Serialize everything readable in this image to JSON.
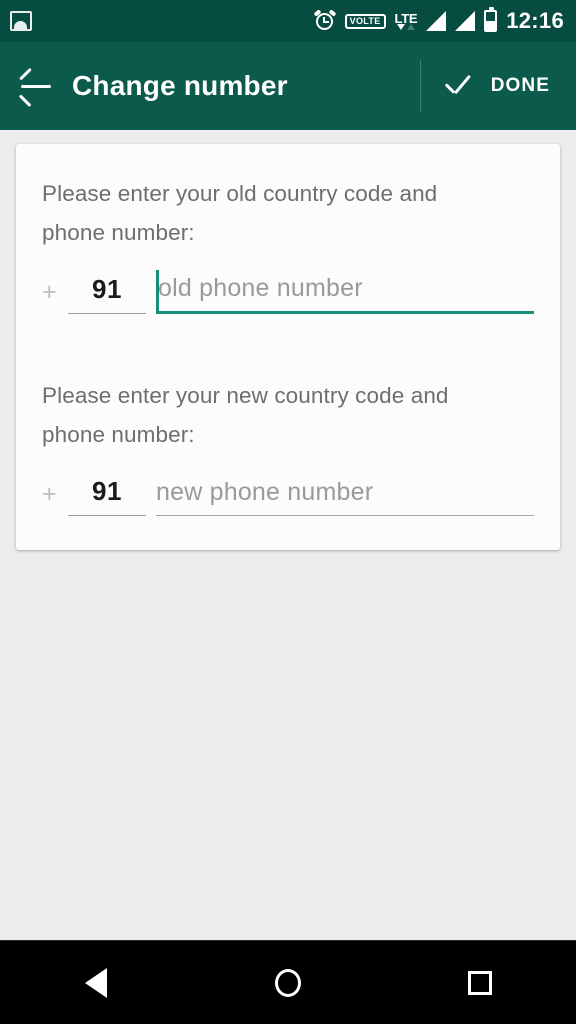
{
  "status_bar": {
    "notification_icon": "photo-icon",
    "alarm_icon": "alarm-clock-icon",
    "volte_label": "VOLTE",
    "network_label": "LTE",
    "signal_bars": 2,
    "battery_level": "50",
    "time": "12:16",
    "background_color": "#074c41"
  },
  "app_bar": {
    "back_icon": "arrow-left-icon",
    "title": "Change number",
    "check_icon": "check-icon",
    "done_label": "DONE",
    "background_color": "#0b5a4b"
  },
  "form": {
    "old": {
      "prompt": "Please enter your old country code and phone number:",
      "plus_prefix": "+",
      "country_code": "91",
      "phone_placeholder": "old phone number",
      "phone_value": "",
      "focused": true,
      "underline_color": "#1a8c7a"
    },
    "new": {
      "prompt": "Please enter your new country code and phone number:",
      "plus_prefix": "+",
      "country_code": "91",
      "phone_placeholder": "new phone number",
      "phone_value": "",
      "focused": false,
      "underline_color": "#a5a5a5"
    }
  },
  "nav_bar": {
    "back_icon": "triangle-back-icon",
    "home_icon": "circle-home-icon",
    "recents_icon": "square-recents-icon",
    "background_color": "#000000"
  }
}
